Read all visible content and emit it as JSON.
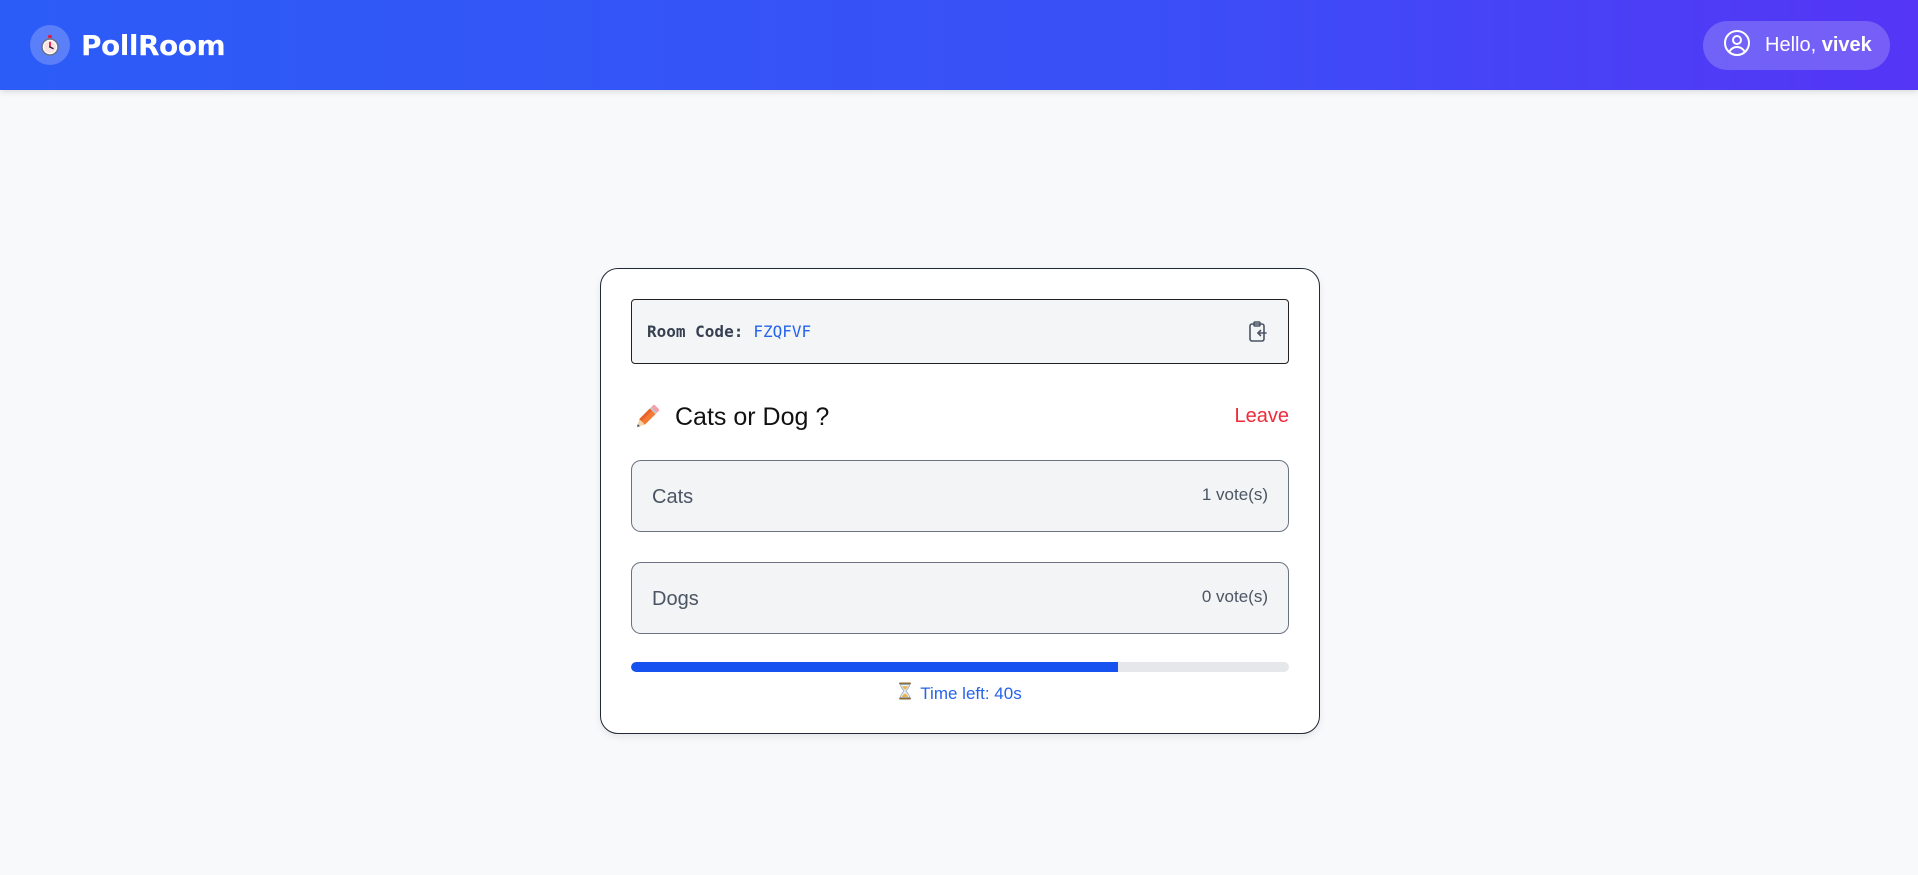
{
  "header": {
    "brand": "PollRoom",
    "greeting": "Hello,",
    "username": "vivek"
  },
  "room": {
    "code_label": "Room Code:",
    "code": "FZQFVF"
  },
  "poll": {
    "title": "Cats or Dog ?",
    "leave_label": "Leave",
    "options": [
      {
        "label": "Cats",
        "votes": "1 vote(s)"
      },
      {
        "label": "Dogs",
        "votes": "0 vote(s)"
      }
    ]
  },
  "timer": {
    "label": "Time left: 40s",
    "progress_percent": 74
  },
  "colors": {
    "accent": "#2563eb",
    "leave": "#ef2b3a",
    "progress": "#1652f0"
  }
}
